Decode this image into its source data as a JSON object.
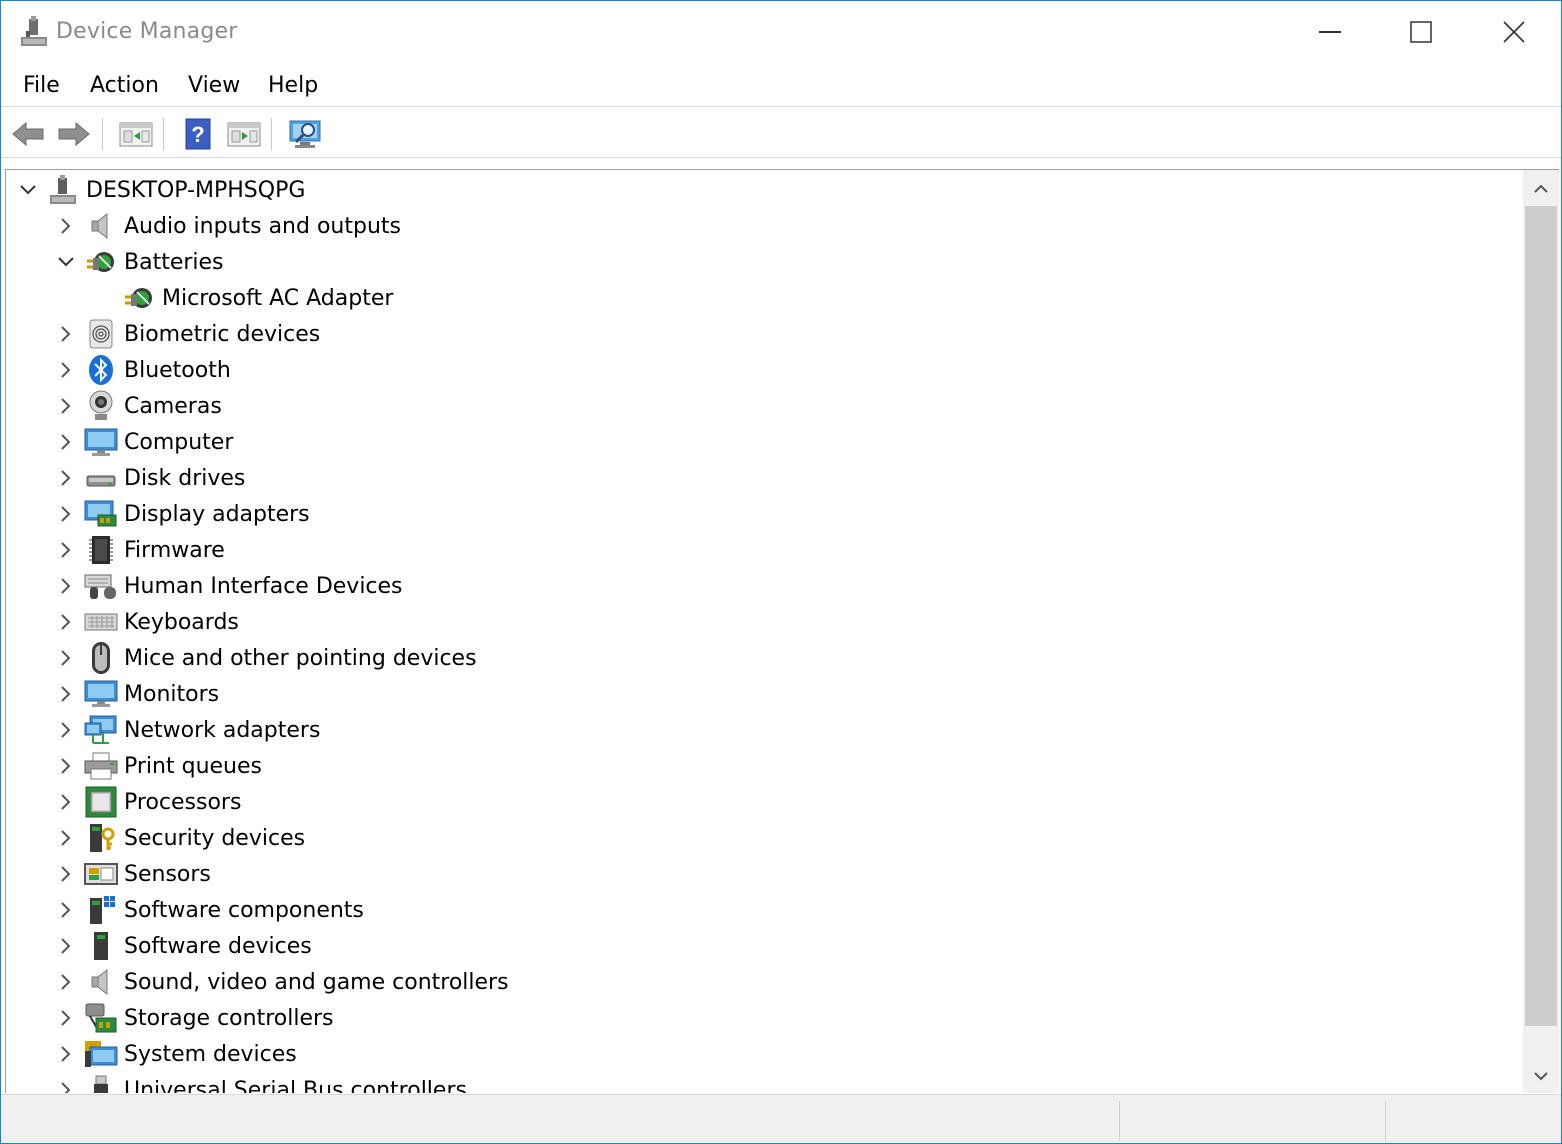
{
  "window": {
    "title": "Device Manager",
    "accent": "#1883d7"
  },
  "menu": [
    "File",
    "Action",
    "View",
    "Help"
  ],
  "toolbar": {
    "icons": [
      "back-arrow-icon",
      "forward-arrow-icon",
      "properties-icon",
      "help-icon",
      "update-driver-icon",
      "scan-hardware-icon"
    ]
  },
  "tree": {
    "root": "DESKTOP-MPHSQPG",
    "items": [
      {
        "label": "Audio inputs and outputs",
        "icon": "speaker-icon",
        "expanded": false
      },
      {
        "label": "Batteries",
        "icon": "battery-icon",
        "expanded": true
      },
      {
        "label": "Microsoft AC Adapter",
        "icon": "battery-icon",
        "child": true
      },
      {
        "label": "Biometric devices",
        "icon": "fingerprint-icon",
        "expanded": false
      },
      {
        "label": "Bluetooth",
        "icon": "bluetooth-icon",
        "expanded": false
      },
      {
        "label": "Cameras",
        "icon": "camera-icon",
        "expanded": false
      },
      {
        "label": "Computer",
        "icon": "computer-icon",
        "expanded": false
      },
      {
        "label": "Disk drives",
        "icon": "disk-drive-icon",
        "expanded": false
      },
      {
        "label": "Display adapters",
        "icon": "display-adapter-icon",
        "expanded": false
      },
      {
        "label": "Firmware",
        "icon": "chip-icon",
        "expanded": false
      },
      {
        "label": "Human Interface Devices",
        "icon": "hid-icon",
        "expanded": false
      },
      {
        "label": "Keyboards",
        "icon": "keyboard-icon",
        "expanded": false
      },
      {
        "label": "Mice and other pointing devices",
        "icon": "mouse-icon",
        "expanded": false
      },
      {
        "label": "Monitors",
        "icon": "monitor-icon",
        "expanded": false
      },
      {
        "label": "Network adapters",
        "icon": "network-icon",
        "expanded": false
      },
      {
        "label": "Print queues",
        "icon": "printer-icon",
        "expanded": false
      },
      {
        "label": "Processors",
        "icon": "processor-icon",
        "expanded": false
      },
      {
        "label": "Security devices",
        "icon": "security-icon",
        "expanded": false
      },
      {
        "label": "Sensors",
        "icon": "sensor-icon",
        "expanded": false
      },
      {
        "label": "Software components",
        "icon": "software-component-icon",
        "expanded": false
      },
      {
        "label": "Software devices",
        "icon": "software-device-icon",
        "expanded": false
      },
      {
        "label": "Sound, video and game controllers",
        "icon": "speaker-icon",
        "expanded": false
      },
      {
        "label": "Storage controllers",
        "icon": "storage-icon",
        "expanded": false
      },
      {
        "label": "System devices",
        "icon": "system-icon",
        "expanded": false
      },
      {
        "label": "Universal Serial Bus controllers",
        "icon": "usb-icon",
        "expanded": false
      }
    ]
  }
}
